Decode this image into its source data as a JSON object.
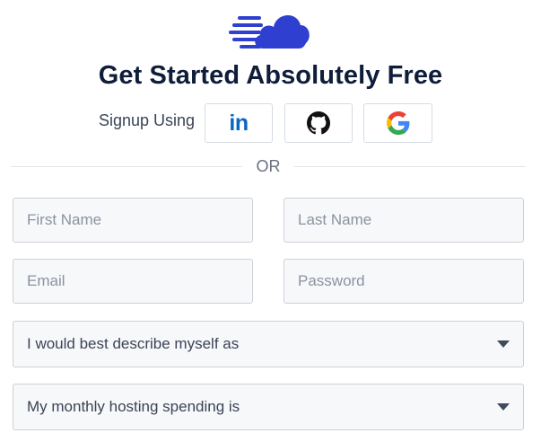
{
  "brand": {
    "logo_icon": "cloud-speed-icon",
    "logo_color": "#2f3fcf"
  },
  "heading": {
    "title": "Get Started Absolutely Free"
  },
  "social": {
    "signup_label": "Signup Using",
    "linkedin_text": "in",
    "buttons": [
      {
        "icon": "linkedin-icon",
        "color": "#0a66c2"
      },
      {
        "icon": "github-icon",
        "color": "#111111"
      },
      {
        "icon": "google-icon",
        "color": "#4285f4"
      }
    ]
  },
  "divider": {
    "text": "OR"
  },
  "form": {
    "first_name_placeholder": "First Name",
    "last_name_placeholder": "Last Name",
    "email_placeholder": "Email",
    "password_placeholder": "Password",
    "describe_select": "I would best describe myself as",
    "hosting_select": "My monthly hosting spending is"
  }
}
